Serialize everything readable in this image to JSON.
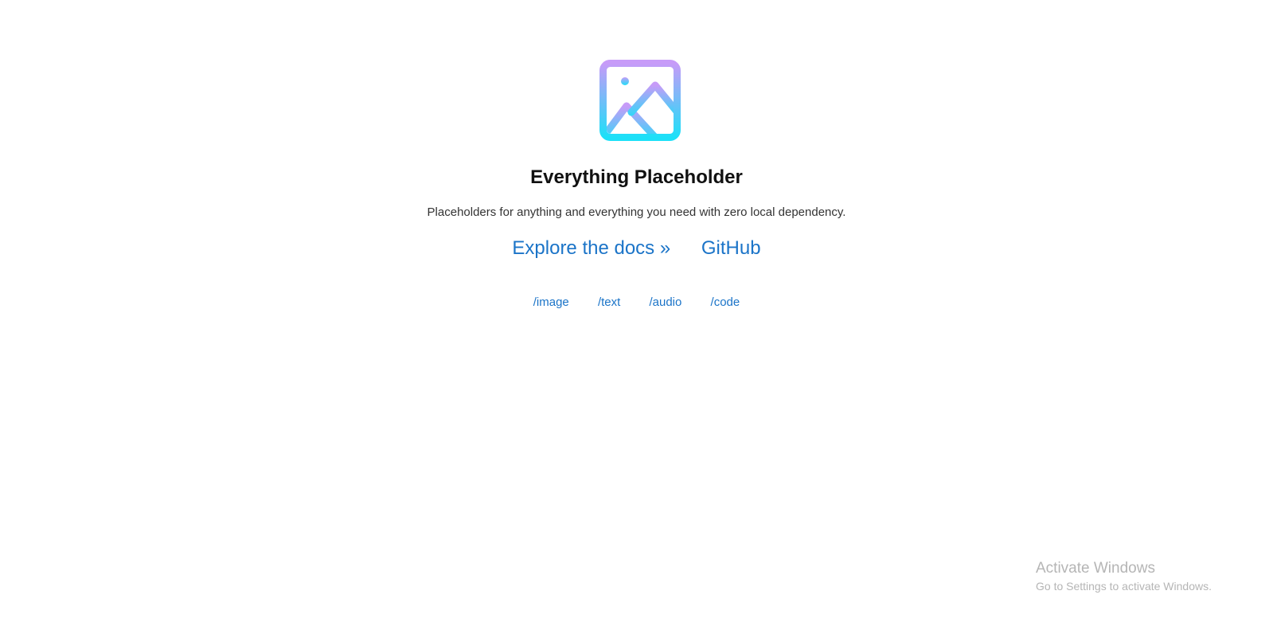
{
  "hero": {
    "logo_icon": "image-placeholder-icon",
    "logo_gradient": [
      "#c79bf8",
      "#1ce0f8"
    ],
    "title": "Everything Placeholder",
    "subtitle": "Placeholders for anything and everything you need with zero local dependency."
  },
  "links": {
    "docs": "Explore the docs »",
    "github": "GitHub",
    "link_color": "#1b74c8"
  },
  "endpoints": [
    "/image",
    "/text",
    "/audio",
    "/code"
  ],
  "watermark": {
    "title": "Activate Windows",
    "subtitle": "Go to Settings to activate Windows."
  }
}
